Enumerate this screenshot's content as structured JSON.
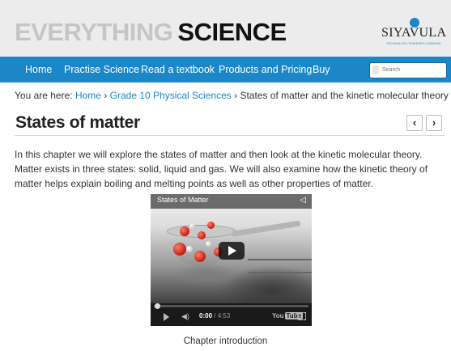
{
  "brand": {
    "part1": "EVERYTHING",
    "part2": "SCIENCE"
  },
  "logo": {
    "name": "SIYAVULA",
    "tagline": "TECHNOLOGY-POWERED LEARNING",
    "accent": "#1b87c9"
  },
  "nav": {
    "items": [
      "Home",
      "Practise Science",
      "Read a textbook",
      "Products and Pricing",
      "Buy"
    ],
    "search_placeholder": "Search",
    "background": "#1b87c9"
  },
  "breadcrumb": {
    "prefix": "You are here:",
    "links": [
      "Home",
      "Grade 10 Physical Sciences"
    ],
    "separator": "›",
    "current": "States of matter and the kinetic molecular theory"
  },
  "page": {
    "title": "States of matter",
    "prev_icon": "chevron-left-icon",
    "next_icon": "chevron-right-icon",
    "intro": "In this chapter we will explore the states of matter and then look at the kinetic molecular theory. Matter exists in three states: solid, liquid and gas. We will also examine how the kinetic theory of matter helps explain boiling and melting points as well as other properties of matter."
  },
  "video": {
    "title": "States of Matter",
    "current_time": "0:00",
    "duration": "/ 4:53",
    "brand": "You",
    "brand_box": "Tube",
    "progress": 0,
    "caption": "Chapter introduction"
  }
}
